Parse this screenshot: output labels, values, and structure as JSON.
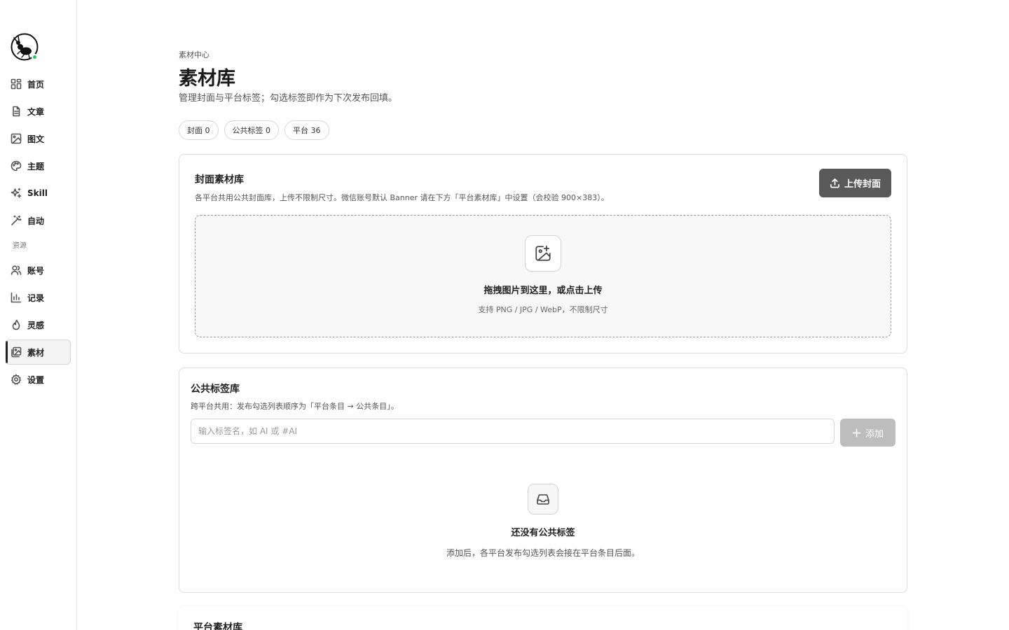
{
  "sidebar": {
    "status_color": "#22c55e",
    "items": [
      {
        "label": "首页",
        "icon": "dashboard-icon"
      },
      {
        "label": "文章",
        "icon": "document-icon"
      },
      {
        "label": "图文",
        "icon": "image-icon"
      },
      {
        "label": "主题",
        "icon": "palette-icon"
      },
      {
        "label": "Skill",
        "icon": "sparkles-icon"
      },
      {
        "label": "自动",
        "icon": "magic-wand-icon"
      }
    ],
    "section_label": "资源",
    "resource_items": [
      {
        "label": "账号",
        "icon": "users-icon"
      },
      {
        "label": "记录",
        "icon": "bar-chart-icon"
      },
      {
        "label": "灵感",
        "icon": "flame-icon"
      },
      {
        "label": "素材",
        "icon": "images-icon",
        "active": true
      },
      {
        "label": "设置",
        "icon": "gear-icon"
      }
    ]
  },
  "header": {
    "breadcrumb": "素材中心",
    "title": "素材库",
    "subtitle": "管理封面与平台标签；勾选标签即作为下次发布回填。"
  },
  "stats": [
    {
      "label": "封面 0"
    },
    {
      "label": "公共标签 0"
    },
    {
      "label": "平台 36"
    }
  ],
  "cover_library": {
    "title": "封面素材库",
    "description": "各平台共用公共封面库，上传不限制尺寸。微信账号默认 Banner 请在下方「平台素材库」中设置（会校验 900×383）。",
    "upload_button": "上传封面",
    "dropzone_title": "拖拽图片到这里，或点击上传",
    "dropzone_hint": "支持 PNG / JPG / WebP，不限制尺寸"
  },
  "tag_library": {
    "title": "公共标签库",
    "description": "跨平台共用：发布勾选列表顺序为「平台条目 → 公共条目」。",
    "input_placeholder": "输入标签名，如 AI 或 #AI",
    "add_button": "添加",
    "empty_title": "还没有公共标签",
    "empty_desc": "添加后，各平台发布勾选列表会接在平台条目后面。"
  },
  "platform_library": {
    "title": "平台素材库"
  }
}
